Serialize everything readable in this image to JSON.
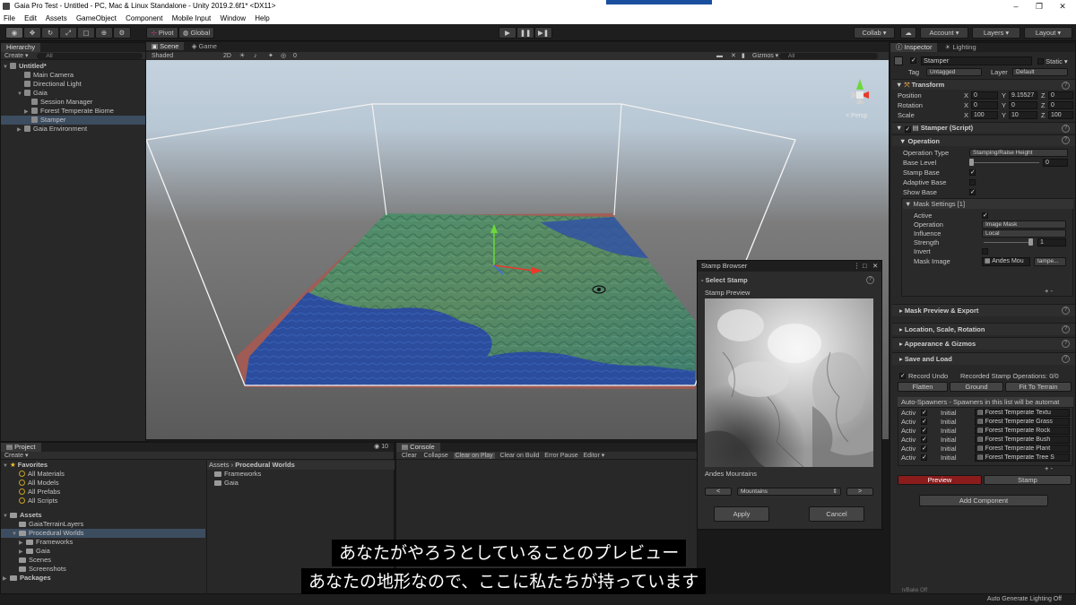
{
  "window": {
    "title": "Gaia Pro Test - Untitled - PC, Mac & Linux Standalone - Unity 2019.2.6f1* <DX11>",
    "minimize": "–",
    "maximize": "❐",
    "close": "✕"
  },
  "menu": [
    "File",
    "Edit",
    "Assets",
    "GameObject",
    "Component",
    "Mobile Input",
    "Window",
    "Help"
  ],
  "toolbar": {
    "pivot": "Pivot",
    "global": "Global",
    "collab": "Collab ▾",
    "account": "Account ▾",
    "layers": "Layers ▾",
    "layout": "Layout ▾"
  },
  "hierarchy": {
    "tab": "Hierarchy",
    "create": "Create ▾",
    "search": "All",
    "items": [
      "Untitled*",
      "Main Camera",
      "Directional Light",
      "Gaia",
      "Session Manager",
      "Forest Temperate Biome",
      "Stamper",
      "Gaia Environment"
    ]
  },
  "scene": {
    "tab_scene": "Scene",
    "tab_game": "Game",
    "shading": "Shaded",
    "mode2d": "2D",
    "gizmos": "Gizmos ▾",
    "search": "All",
    "persp": "< Persp",
    "layer_count": "0"
  },
  "inspector": {
    "tab": "Inspector",
    "tab2": "Lighting",
    "name": "Stamper",
    "static": "Static ▾",
    "tag_label": "Tag",
    "tag_value": "Untagged",
    "layer_label": "Layer",
    "layer_value": "Default",
    "transform": "Transform",
    "position_label": "Position",
    "pos": [
      "0",
      "9.15527",
      "0"
    ],
    "rotation_label": "Rotation",
    "rot": [
      "0",
      "0",
      "0"
    ],
    "scale_label": "Scale",
    "scl": [
      "100",
      "10",
      "100"
    ],
    "axis": [
      "X",
      "Y",
      "Z"
    ],
    "script": "Stamper (Script)",
    "operation_section": "Operation",
    "op_type_label": "Operation Type",
    "op_type_value": "Stamping/Raise Height",
    "base_level_label": "Base Level",
    "base_level_value": "0",
    "stamp_base_label": "Stamp Base",
    "adaptive_base_label": "Adaptive Base",
    "show_base_label": "Show Base",
    "mask_settings": "Mask Settings [1]",
    "active_label": "Active",
    "operation_label": "Operation",
    "operation_value": "Image Mask",
    "influence_label": "Influence",
    "influence_value": "Local",
    "strength_label": "Strength",
    "strength_value": "1",
    "invert_label": "Invert",
    "mask_image_label": "Mask Image",
    "mask_image_value": "Andes Mou",
    "mask_image_btn": "tampe...",
    "plus": "+ -",
    "mask_preview": "Mask Preview & Export",
    "location": "Location, Scale, Rotation",
    "appearance": "Appearance & Gizmos",
    "save_load": "Save and Load",
    "record_undo": "Record Undo",
    "recorded_ops": "Recorded Stamp Operations: 0/0",
    "flatten": "Flatten",
    "ground": "Ground",
    "fit": "Fit To Terrain",
    "autospawners": "Auto-Spawners - Spawners in this list will be automat",
    "spawner_active": "Activ",
    "spawner_initial": "Initial",
    "spawners": [
      "Forest Temperate Textu",
      "Forest Temperate Grass",
      "Forest Temperate Rock",
      "Forest Temperate Bush",
      "Forest Temperate Plant",
      "Forest Temperate Tree S"
    ],
    "preview_btn": "Preview",
    "stamp_btn": "Stamp",
    "add_component": "Add Component"
  },
  "project": {
    "tab": "Project",
    "create": "Create ▾",
    "favorites": "Favorites",
    "fav_items": [
      "All Materials",
      "All Models",
      "All Prefabs",
      "All Scripts"
    ],
    "assets": "Assets",
    "asset_items": [
      "GaiaTerrainLayers",
      "Procedural Worlds",
      "Frameworks",
      "Gaia",
      "Scenes",
      "Screenshots"
    ],
    "packages": "Packages",
    "breadcrumb_root": "Assets",
    "breadcrumb_sep": "›",
    "breadcrumb_current": "Procedural Worlds",
    "folder_items": [
      "Frameworks",
      "Gaia"
    ],
    "count": "10"
  },
  "console": {
    "tab": "Console",
    "buttons": [
      "Clear",
      "Collapse",
      "Clear on Play",
      "Clear on Build",
      "Error Pause",
      "Editor ▾"
    ]
  },
  "stamp_browser": {
    "title": "Stamp Browser",
    "select": "Select Stamp",
    "preview_label": "Stamp Preview",
    "stamp_name": "Andes Mountains",
    "prev": "<",
    "category": "Mountains",
    "next": ">",
    "apply": "Apply",
    "cancel": "Cancel"
  },
  "subtitles": {
    "line1": "あなたがやろうとしていることのプレビュー",
    "line2": "あなたの地形なので、ここに私たちが持っています"
  },
  "status": {
    "right": "Auto Generate Lighting Off",
    "mini": "n/Bake Off"
  }
}
